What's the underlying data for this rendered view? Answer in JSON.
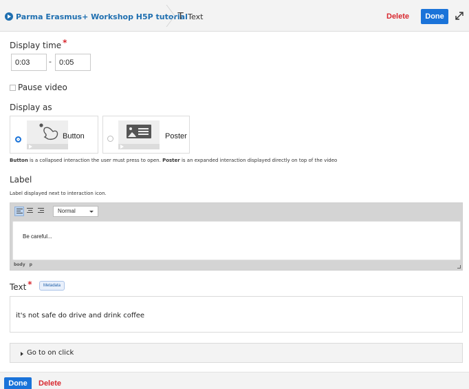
{
  "topbar": {
    "breadcrumb_parent": "Parma Erasmus+ Workshop H5P tutorial",
    "breadcrumb_current_icon": "text-icon",
    "breadcrumb_current_icon_glyph": "T",
    "breadcrumb_current": "Text",
    "delete_label": "Delete",
    "done_label": "Done",
    "expand_icon": "expand-icon"
  },
  "display_time": {
    "title": "Display time",
    "required_mark": "*",
    "from_value": "0:03",
    "separator": "-",
    "to_value": "0:05"
  },
  "pause_video": {
    "label": "Pause video",
    "checked": false
  },
  "display_as": {
    "title": "Display as",
    "options": [
      {
        "label": "Button",
        "selected": true,
        "icon": "touch-icon"
      },
      {
        "label": "Poster",
        "selected": false,
        "icon": "poster-icon"
      }
    ],
    "description_parts": [
      {
        "text": "Button",
        "bold": true
      },
      {
        "text": " is a collapsed interaction the user must press to open. ",
        "bold": false
      },
      {
        "text": "Poster",
        "bold": true
      },
      {
        "text": " is an expanded interaction displayed directly on top of the video",
        "bold": false
      }
    ]
  },
  "label_field": {
    "title": "Label",
    "description": "Label displayed next to interaction icon.",
    "toolbar": {
      "align_left_icon": "align-left-icon",
      "align_center_icon": "align-center-icon",
      "align_right_icon": "align-right-icon",
      "format_value": "Normal"
    },
    "editor_value": "Be careful...",
    "status_path": [
      "body",
      "p"
    ]
  },
  "text_field": {
    "title": "Text",
    "required_mark": "*",
    "metadata_label": "Metadata",
    "value": "it's not safe do drive and drink coffee"
  },
  "go_to": {
    "label": "Go to on click"
  },
  "footer": {
    "done_label": "Done",
    "delete_label": "Delete"
  },
  "colors": {
    "accent": "#1a73d9",
    "danger": "#d8282f",
    "bar_bg": "#f3f3f3"
  }
}
